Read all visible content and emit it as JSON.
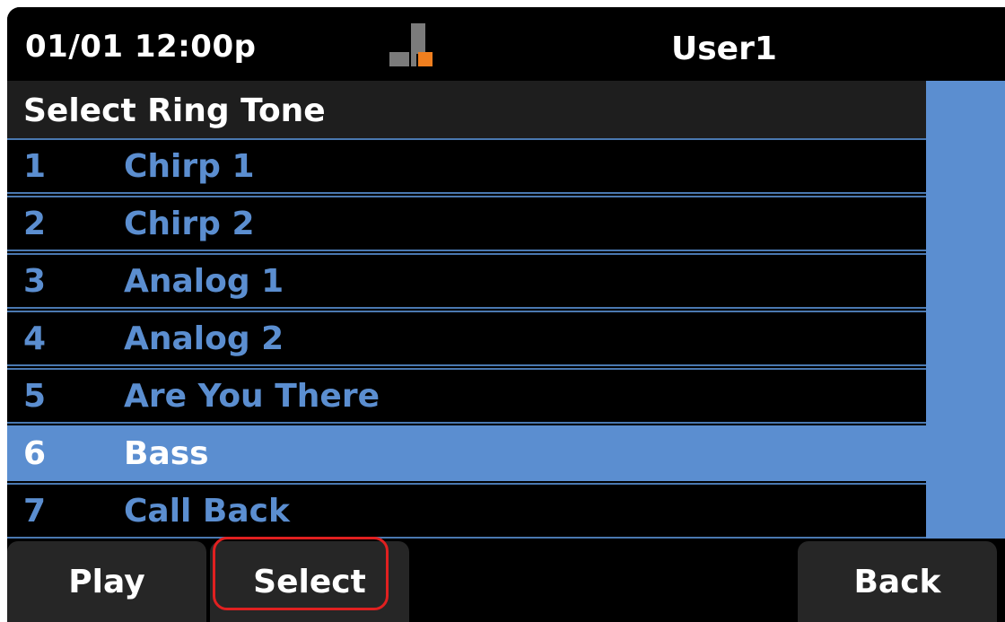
{
  "status": {
    "clock": "01/01 12:00p",
    "network_icon": "network-status-icon",
    "user": "User1"
  },
  "list": {
    "title": "Select Ring Tone",
    "items": [
      {
        "num": "1",
        "name": "Chirp 1"
      },
      {
        "num": "2",
        "name": "Chirp 2"
      },
      {
        "num": "3",
        "name": "Analog 1"
      },
      {
        "num": "4",
        "name": "Analog 2"
      },
      {
        "num": "5",
        "name": "Are You There"
      },
      {
        "num": "6",
        "name": "Bass"
      },
      {
        "num": "7",
        "name": "Call Back"
      }
    ],
    "selected_index": 5
  },
  "softkeys": {
    "play": "Play",
    "select": "Select",
    "back": "Back"
  },
  "colors": {
    "accent": "#5b8ed0",
    "highlight_ring": "#e02020",
    "network_active": "#f07f1f"
  }
}
